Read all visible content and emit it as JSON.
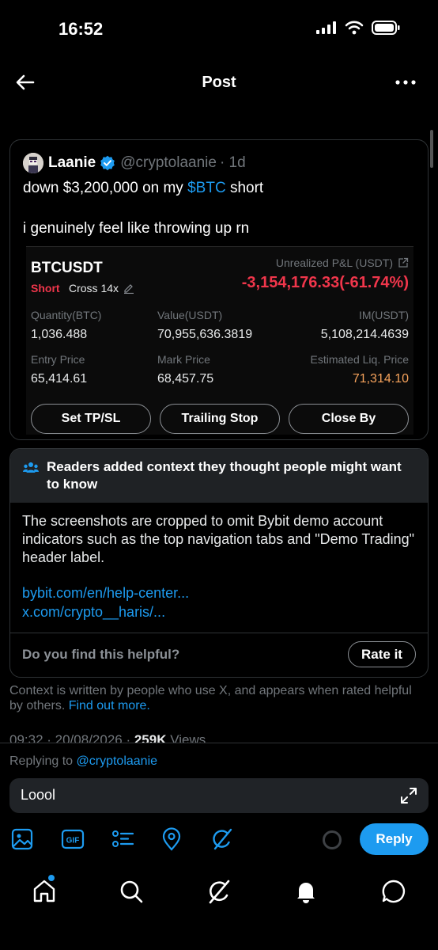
{
  "status_bar": {
    "time": "16:52"
  },
  "header": {
    "title": "Post"
  },
  "quoted_post": {
    "author_name": "Laanie",
    "author_handle": "@cryptolaanie",
    "age": "· 1d",
    "text_before_cashtag": "down $3,200,000 on my ",
    "cashtag": "$BTC",
    "text_after_cashtag": " short",
    "text_line2": "i genuinely feel like throwing up rn"
  },
  "position": {
    "symbol": "BTCUSDT",
    "side": "Short",
    "margin": "Cross 14x",
    "upnl_label": "Unrealized P&L (USDT)",
    "upnl_value": "-3,154,176.33(-61.74%)",
    "fields": [
      {
        "label": "Quantity(BTC)",
        "value": "1,036.488"
      },
      {
        "label": "Value(USDT)",
        "value": "70,955,636.3819"
      },
      {
        "label": "IM(USDT)",
        "value": "5,108,214.4639"
      },
      {
        "label": "Entry Price",
        "value": "65,414.61"
      },
      {
        "label": "Mark Price",
        "value": "68,457.75"
      },
      {
        "label": "Estimated Liq. Price",
        "value": "71,314.10"
      }
    ],
    "buttons": [
      "Set TP/SL",
      "Trailing Stop",
      "Close By"
    ]
  },
  "community_note": {
    "title": "Readers added context they thought people might want to know",
    "body": "The screenshots are cropped to omit Bybit demo account indicators such as the top navigation tabs and \"Demo Trading\" header label.",
    "links": [
      "bybit.com/en/help-center...",
      "x.com/crypto__haris/..."
    ],
    "helpful_question": "Do you find this helpful?",
    "rate_label": "Rate it"
  },
  "context_footer": {
    "text": "Context is written by people who use X, and appears when rated helpful by others. ",
    "link": "Find out more."
  },
  "post_meta": {
    "timestamp": "09:32 · 20/08/2026 · ",
    "views_count": "259K",
    "views_label": " Views"
  },
  "composer": {
    "replying_prefix": "Replying to ",
    "replying_handle": "@cryptolaanie",
    "input_value": "Loool",
    "reply_label": "Reply",
    "tools": [
      "image-icon",
      "gif-icon",
      "poll-icon",
      "location-icon",
      "grok-icon"
    ]
  },
  "bottom_nav": [
    "home-icon",
    "search-icon",
    "grok-icon",
    "notifications-icon",
    "messages-icon"
  ],
  "colors": {
    "accent": "#1d9bf0",
    "loss": "#f0364b",
    "liq": "#f7a35c",
    "background": "#000000"
  }
}
